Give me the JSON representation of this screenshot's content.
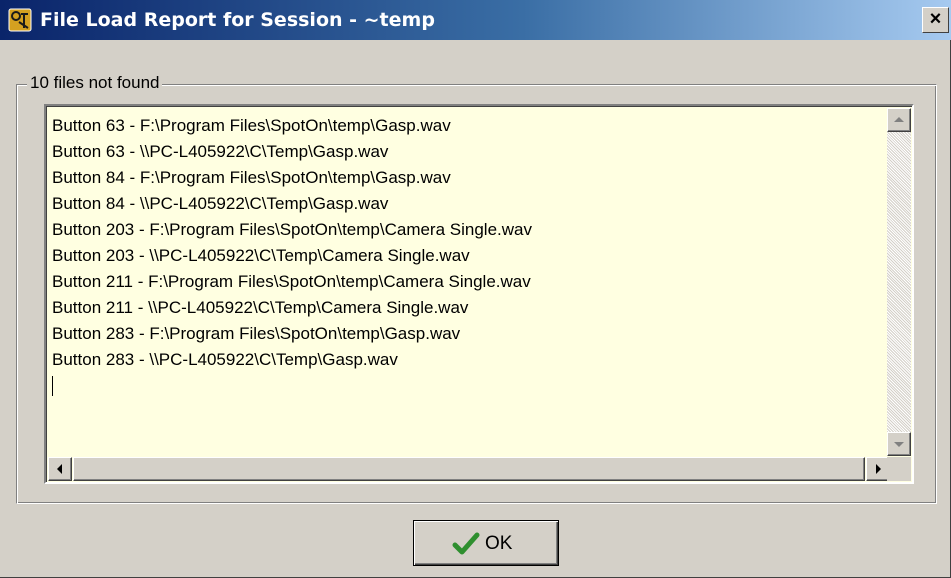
{
  "window": {
    "title": "File Load Report for Session - ~temp",
    "close_label": "×",
    "app_icon": "spoton-app-icon",
    "title_bar_colors": [
      "#0a246a",
      "#a6caf0"
    ]
  },
  "group": {
    "label": "10 files not found"
  },
  "report": {
    "lines": [
      "Button 63 - F:\\Program Files\\SpotOn\\temp\\Gasp.wav",
      "Button 63 - \\\\PC-L405922\\C\\Temp\\Gasp.wav",
      "Button 84 - F:\\Program Files\\SpotOn\\temp\\Gasp.wav",
      "Button 84 - \\\\PC-L405922\\C\\Temp\\Gasp.wav",
      "Button 203 - F:\\Program Files\\SpotOn\\temp\\Camera Single.wav",
      "Button 203 - \\\\PC-L405922\\C\\Temp\\Camera Single.wav",
      "Button 211 - F:\\Program Files\\SpotOn\\temp\\Camera Single.wav",
      "Button 211 - \\\\PC-L405922\\C\\Temp\\Camera Single.wav",
      "Button 283 - F:\\Program Files\\SpotOn\\temp\\Gasp.wav",
      "Button 283 - \\\\PC-L405922\\C\\Temp\\Gasp.wav"
    ],
    "background": "#ffffe1"
  },
  "ok_button": {
    "label": "OK",
    "icon": "checkmark-icon",
    "icon_color": "#2f8f2f"
  }
}
